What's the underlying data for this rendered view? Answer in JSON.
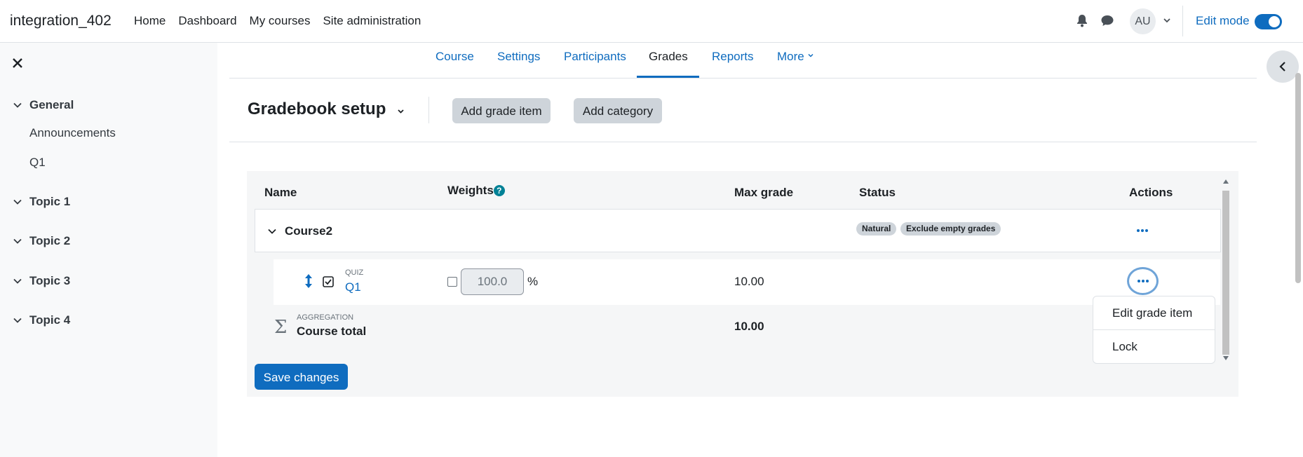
{
  "navbar": {
    "brand": "integration_402",
    "items": [
      "Home",
      "Dashboard",
      "My courses",
      "Site administration"
    ],
    "avatar_initials": "AU",
    "edit_mode_label": "Edit mode",
    "edit_mode_on": true
  },
  "drawer": {
    "sections": [
      {
        "label": "General",
        "items": [
          "Announcements",
          "Q1"
        ]
      },
      {
        "label": "Topic 1",
        "items": []
      },
      {
        "label": "Topic 2",
        "items": []
      },
      {
        "label": "Topic 3",
        "items": []
      },
      {
        "label": "Topic 4",
        "items": []
      }
    ]
  },
  "secondary_nav": {
    "tabs": [
      "Course",
      "Settings",
      "Participants",
      "Grades",
      "Reports",
      "More"
    ],
    "active": "Grades"
  },
  "header": {
    "title": "Gradebook setup",
    "add_grade_item": "Add grade item",
    "add_category": "Add category"
  },
  "table": {
    "columns": {
      "name": "Name",
      "weights": "Weights",
      "weights_help": "?",
      "max_grade": "Max grade",
      "status": "Status",
      "actions": "Actions"
    },
    "category": {
      "name": "Course2",
      "badges": [
        "Natural",
        "Exclude empty grades"
      ]
    },
    "item": {
      "type": "QUIZ",
      "name": "Q1",
      "weight": "100.0",
      "weight_unit": "%",
      "max_grade": "10.00"
    },
    "total": {
      "type": "AGGREGATION",
      "name": "Course total",
      "max_grade": "10.00",
      "symbol": "Σ"
    },
    "menu": [
      "Edit grade item",
      "Lock"
    ],
    "save_label": "Save changes"
  },
  "colors": {
    "accent": "#0f6cbf",
    "help": "#008196",
    "badge": "#ced4da"
  }
}
